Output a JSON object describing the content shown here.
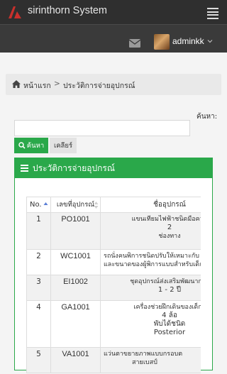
{
  "header": {
    "app_title": "sirinthorn System",
    "user": {
      "name": "adminkk"
    }
  },
  "breadcrumb": {
    "home": "หน้าแรก",
    "separator": ">",
    "current": "ประวัติการจ่ายอุปกรณ์"
  },
  "search": {
    "label": "ค้นหา:",
    "value": "",
    "search_button": "ค้นหา",
    "clear_button": "เคลียร์"
  },
  "panel": {
    "title": "ประวัติการจ่ายอุปกรณ์",
    "columns": {
      "no": "No.",
      "code": "เลขที่อุปกรณ์",
      "name": "ชื่ออุปกรณ์"
    },
    "rows": [
      {
        "no": "1",
        "code": "PO1001",
        "name_lines": [
          "แขนเทียมไฟฟ้าชนิดมือควบ",
          "2",
          "ช่องทาง"
        ]
      },
      {
        "no": "2",
        "code": "WC1001",
        "name_lines": [
          "รถนั่งคนพิการชนิดปรับให้เหมาะกับ",
          "และขนาดของผู้พิการแบบสำหรับเด็กที่"
        ]
      },
      {
        "no": "3",
        "code": "EI1002",
        "name_lines": [
          "ชุดอุปกรณ์ส่งเสริมพัฒนาการ",
          "1 - 2 ปี"
        ]
      },
      {
        "no": "4",
        "code": "GA1001",
        "name_lines": [
          "เครื่องช่วยฝึกเดินของเด็กร",
          "4 ล้อ",
          "พับได้ชนิด",
          "Posterior"
        ]
      },
      {
        "no": "5",
        "code": "VA1001",
        "name_lines": [
          "แว่นตาขยายภาพแบบกรอบต",
          "สายเบสป์"
        ]
      }
    ]
  },
  "colors": {
    "accent": "#2aa84a",
    "topbar": "#2f2f2f",
    "subbar": "#3a3a3a",
    "logo": "#c9302c"
  },
  "icons": [
    "logo-icon",
    "hamburger-icon",
    "mail-icon",
    "chevron-down-icon",
    "home-icon",
    "search-icon",
    "list-icon",
    "sort-asc-icon",
    "sort-icon"
  ]
}
